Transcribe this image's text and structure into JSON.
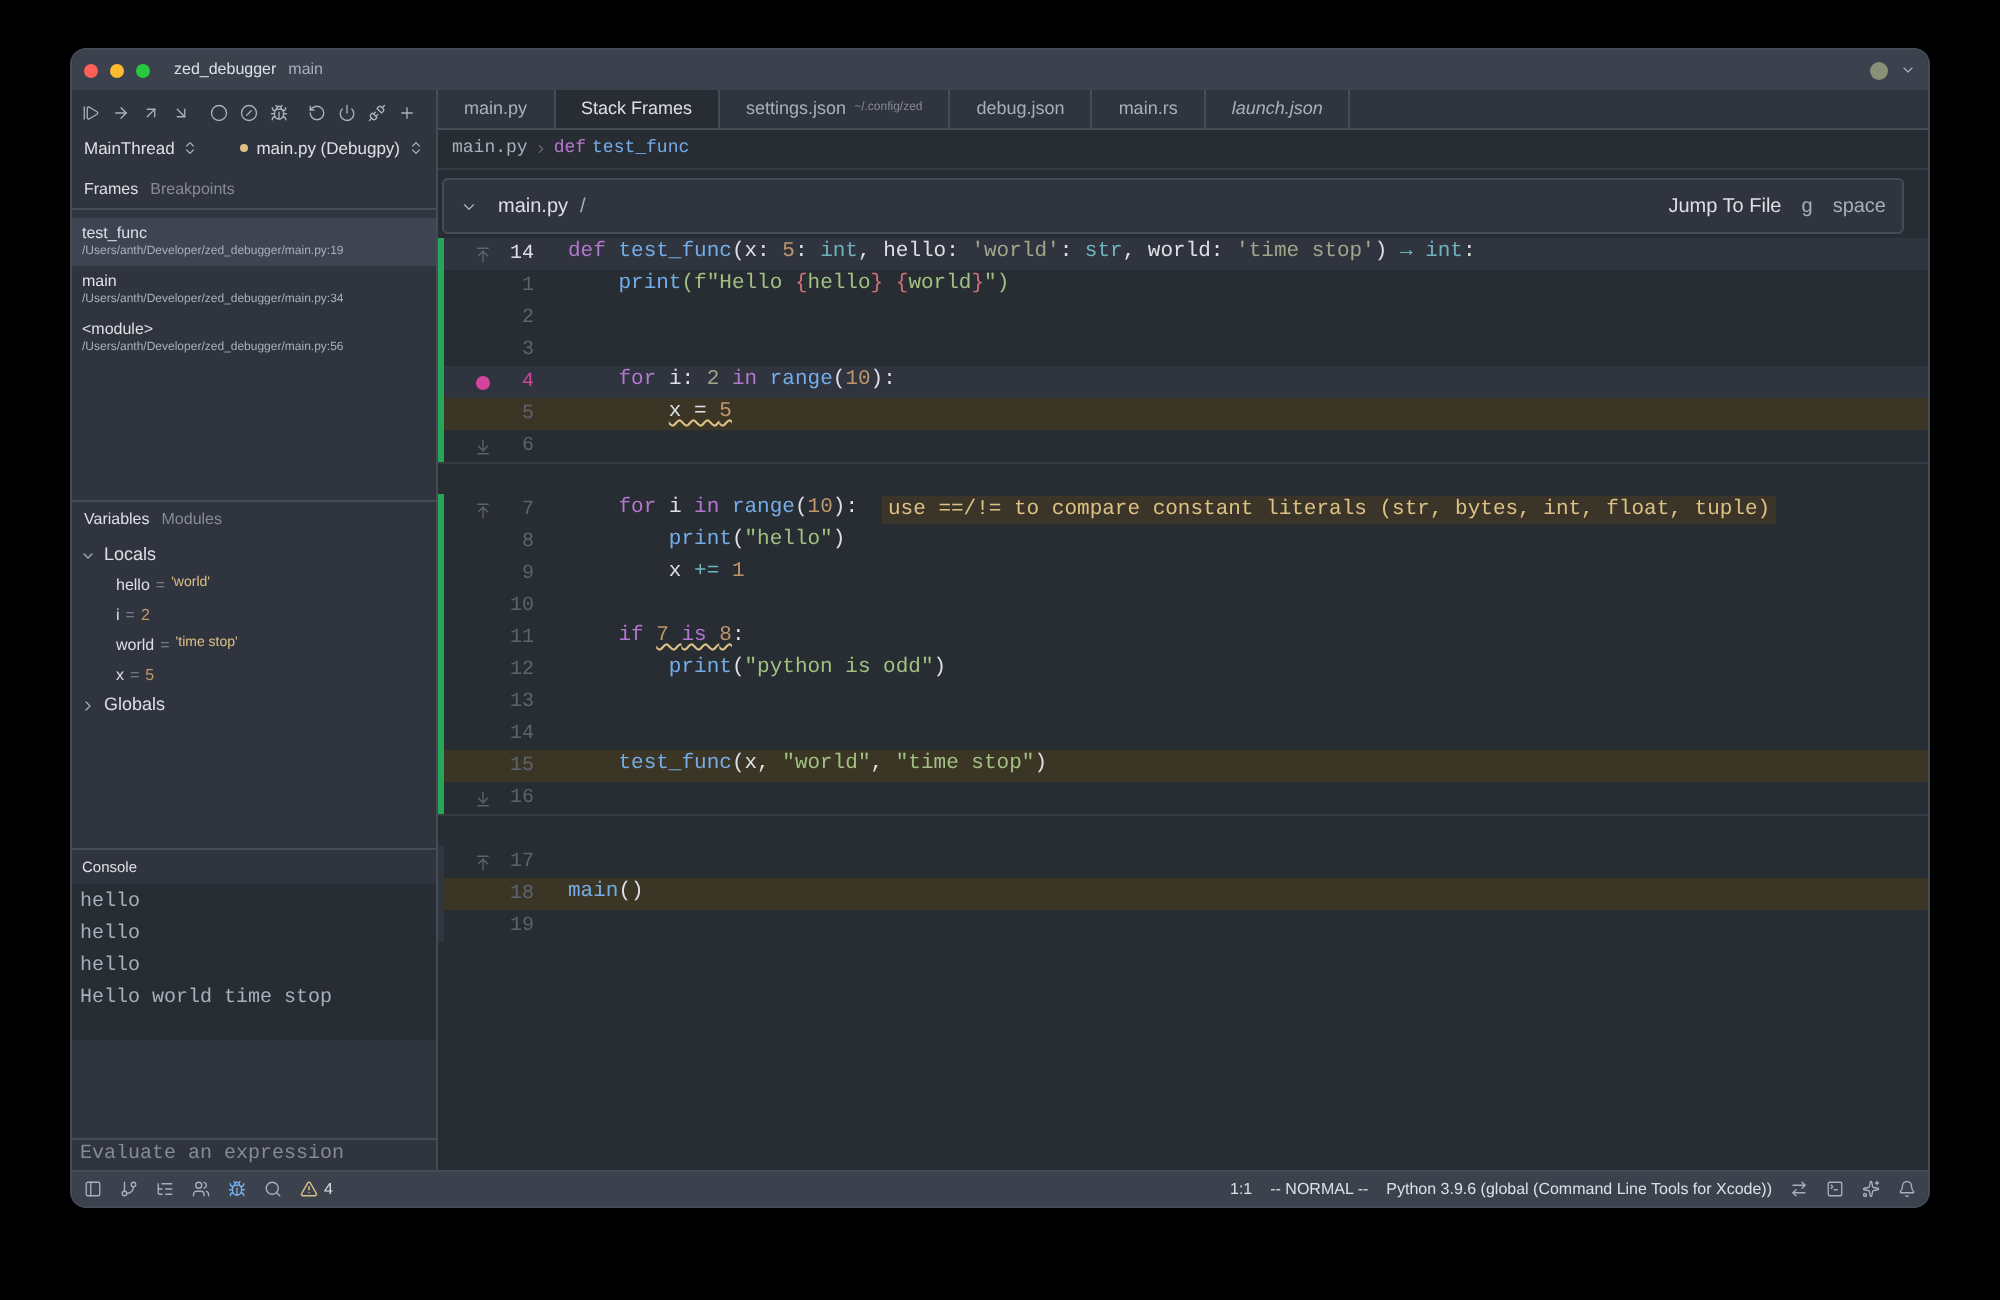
{
  "window": {
    "title": "zed_debugger",
    "branch": "main"
  },
  "debug_panel": {
    "thread": "MainThread",
    "session": "main.py (Debugpy)",
    "frame_tabs": [
      {
        "label": "Frames",
        "selected": true
      },
      {
        "label": "Breakpoints",
        "selected": false
      }
    ],
    "frames": [
      {
        "name": "test_func",
        "path": "/Users/anth/Developer/zed_debugger/main.py:19",
        "selected": true
      },
      {
        "name": "main",
        "path": "/Users/anth/Developer/zed_debugger/main.py:34",
        "selected": false
      },
      {
        "name": "<module>",
        "path": "/Users/anth/Developer/zed_debugger/main.py:56",
        "selected": false
      }
    ],
    "variable_tabs": [
      {
        "label": "Variables",
        "selected": true
      },
      {
        "label": "Modules",
        "selected": false
      }
    ],
    "scopes": [
      {
        "name": "Locals",
        "expanded": true,
        "children": [
          {
            "name": "hello",
            "sign": "=",
            "value": "'world'",
            "kind": "string"
          },
          {
            "name": "i",
            "sign": "=",
            "value": "2",
            "kind": "number"
          },
          {
            "name": "world",
            "sign": "=",
            "value": "'time stop'",
            "kind": "string"
          },
          {
            "name": "x",
            "sign": "=",
            "value": "5",
            "kind": "number"
          }
        ]
      },
      {
        "name": "Globals",
        "expanded": false
      }
    ],
    "console": {
      "title": "Console",
      "lines": [
        "hello",
        "hello",
        "hello",
        "Hello world time stop"
      ],
      "placeholder": "Evaluate an expression"
    }
  },
  "tabs": [
    {
      "label": "main.py",
      "selected": false,
      "preview": false
    },
    {
      "label": "Stack Frames",
      "selected": true,
      "preview": false
    },
    {
      "label": "settings.json",
      "detail": "~/.config/zed",
      "selected": false,
      "preview": false
    },
    {
      "label": "debug.json",
      "selected": false,
      "preview": false
    },
    {
      "label": "main.rs",
      "selected": false,
      "preview": false
    },
    {
      "label": "launch.json",
      "selected": false,
      "preview": true
    }
  ],
  "breadcrumb": {
    "file": "main.py",
    "keyword": "def",
    "symbol": "test_func"
  },
  "excerpt_header": {
    "file": "main.py",
    "path": "/",
    "action": "Jump To File",
    "keys": [
      "g",
      "space"
    ]
  },
  "excerpts": [
    {
      "changed": true,
      "lines": [
        {
          "number": "14",
          "active": true,
          "paused": false,
          "breakpoint": false,
          "expand_up": true,
          "expand_down": false,
          "tokens": [
            {
              "t": "def ",
              "color": "#b477cf"
            },
            {
              "t": "test_func",
              "color": "#74ade8"
            },
            {
              "t": "(x: ",
              "color": "#dce0e5"
            },
            {
              "t": "5",
              "color": "#bf956a"
            },
            {
              "t": ": ",
              "color": "#dce0e5"
            },
            {
              "t": "int",
              "color": "#6eb4bf"
            },
            {
              "t": ", hello: ",
              "color": "#dce0e5"
            },
            {
              "t": "'world'",
              "color": "#a1a58a"
            },
            {
              "t": ": ",
              "color": "#dce0e5"
            },
            {
              "t": "str",
              "color": "#6eb4bf"
            },
            {
              "t": ", world: ",
              "color": "#dce0e5"
            },
            {
              "t": "'time stop'",
              "color": "#a1a58a"
            },
            {
              "t": ") ",
              "color": "#dce0e5"
            },
            {
              "t": "→ int",
              "color": "#6eb4bf"
            },
            {
              "t": ":",
              "color": "#dce0e5"
            }
          ]
        },
        {
          "number": "1",
          "active": false,
          "paused": false,
          "breakpoint": false,
          "expand_up": false,
          "expand_down": false,
          "tokens": [
            {
              "t": "    print",
              "color": "#74ade8"
            },
            {
              "t": "(f\"Hello ",
              "color": "#a1c181"
            },
            {
              "t": "{",
              "color": "#d07277"
            },
            {
              "t": "hello",
              "color": "#a1c181"
            },
            {
              "t": "} ",
              "color": "#d07277"
            },
            {
              "t": "{",
              "color": "#d07277"
            },
            {
              "t": "world",
              "color": "#a1c181"
            },
            {
              "t": "}",
              "color": "#d07277"
            },
            {
              "t": "\")",
              "color": "#a1c181"
            }
          ]
        },
        {
          "number": "2",
          "active": false,
          "paused": false,
          "breakpoint": false,
          "expand_up": false,
          "expand_down": false
        },
        {
          "number": "3",
          "active": false,
          "paused": false,
          "breakpoint": false,
          "expand_up": false,
          "expand_down": false
        },
        {
          "number": "4",
          "active": true,
          "paused": false,
          "breakpoint": true,
          "expand_up": false,
          "expand_down": false,
          "tokens": [
            {
              "t": "    for",
              "color": "#b477cf"
            },
            {
              "t": " i: ",
              "color": "#dce0e5"
            },
            {
              "t": "2 ",
              "color": "#a1a58a"
            },
            {
              "t": "in ",
              "color": "#b477cf"
            },
            {
              "t": "range",
              "color": "#74ade8"
            },
            {
              "t": "(",
              "color": "#dce0e5"
            },
            {
              "t": "10",
              "color": "#bf956a"
            },
            {
              "t": "):",
              "color": "#dce0e5"
            }
          ]
        },
        {
          "number": "5",
          "active": false,
          "paused": true,
          "breakpoint": false,
          "expand_up": false,
          "expand_down": false,
          "tokens": [
            {
              "t": "        x = ",
              "color": "#dce0e5",
              "squiggle": true
            },
            {
              "t": "5",
              "color": "#bf956a",
              "squiggle": true
            }
          ]
        },
        {
          "number": "6",
          "active": false,
          "paused": false,
          "breakpoint": false,
          "expand_up": false,
          "expand_down": true
        }
      ]
    },
    {
      "changed": true,
      "lines": [
        {
          "number": "7",
          "active": false,
          "paused": false,
          "breakpoint": false,
          "expand_up": true,
          "expand_down": false,
          "diagnostic": "use ==/!= to compare constant literals (str, bytes, int, float, tuple)",
          "tokens": [
            {
              "t": "    for",
              "color": "#b477cf"
            },
            {
              "t": " i ",
              "color": "#dce0e5"
            },
            {
              "t": "in ",
              "color": "#b477cf"
            },
            {
              "t": "range",
              "color": "#74ade8"
            },
            {
              "t": "(",
              "color": "#dce0e5"
            },
            {
              "t": "10",
              "color": "#bf956a"
            },
            {
              "t": "):",
              "color": "#dce0e5"
            }
          ]
        },
        {
          "number": "8",
          "active": false,
          "paused": false,
          "breakpoint": false,
          "expand_up": false,
          "expand_down": false,
          "tokens": [
            {
              "t": "        print",
              "color": "#74ade8"
            },
            {
              "t": "(",
              "color": "#dce0e5"
            },
            {
              "t": "\"hello\"",
              "color": "#a1c181"
            },
            {
              "t": ")",
              "color": "#dce0e5"
            }
          ]
        },
        {
          "number": "9",
          "active": false,
          "paused": false,
          "breakpoint": false,
          "expand_up": false,
          "expand_down": false,
          "tokens": [
            {
              "t": "        x ",
              "color": "#dce0e5"
            },
            {
              "t": "+= ",
              "color": "#6eb4bf"
            },
            {
              "t": "1",
              "color": "#bf956a"
            }
          ]
        },
        {
          "number": "10",
          "active": false,
          "paused": false,
          "breakpoint": false,
          "expand_up": false,
          "expand_down": false
        },
        {
          "number": "11",
          "active": false,
          "paused": false,
          "breakpoint": false,
          "expand_up": false,
          "expand_down": false,
          "tokens": [
            {
              "t": "    if ",
              "color": "#b477cf"
            },
            {
              "t": "7 ",
              "color": "#bf956a",
              "squiggle": true
            },
            {
              "t": "is ",
              "color": "#b477cf",
              "squiggle": true
            },
            {
              "t": "8",
              "color": "#bf956a",
              "squiggle": true
            },
            {
              "t": ":",
              "color": "#dce0e5"
            }
          ]
        },
        {
          "number": "12",
          "active": false,
          "paused": false,
          "breakpoint": false,
          "expand_up": false,
          "expand_down": false,
          "tokens": [
            {
              "t": "        print",
              "color": "#74ade8"
            },
            {
              "t": "(",
              "color": "#dce0e5"
            },
            {
              "t": "\"python is odd\"",
              "color": "#a1c181"
            },
            {
              "t": ")",
              "color": "#dce0e5"
            }
          ]
        },
        {
          "number": "13",
          "active": false,
          "paused": false,
          "breakpoint": false,
          "expand_up": false,
          "expand_down": false
        },
        {
          "number": "14",
          "active": false,
          "paused": false,
          "breakpoint": false,
          "expand_up": false,
          "expand_down": false
        },
        {
          "number": "15",
          "active": false,
          "paused": true,
          "breakpoint": false,
          "expand_up": false,
          "expand_down": false,
          "tokens": [
            {
              "t": "    test_func",
              "color": "#74ade8"
            },
            {
              "t": "(x, ",
              "color": "#dce0e5"
            },
            {
              "t": "\"world\"",
              "color": "#a1c181"
            },
            {
              "t": ", ",
              "color": "#dce0e5"
            },
            {
              "t": "\"time stop\"",
              "color": "#a1c181"
            },
            {
              "t": ")",
              "color": "#dce0e5"
            }
          ]
        },
        {
          "number": "16",
          "active": false,
          "paused": false,
          "breakpoint": false,
          "expand_up": false,
          "expand_down": true
        }
      ]
    },
    {
      "changed": false,
      "lines": [
        {
          "number": "17",
          "active": false,
          "paused": false,
          "breakpoint": false,
          "expand_up": true,
          "expand_down": false
        },
        {
          "number": "18",
          "active": false,
          "paused": true,
          "breakpoint": false,
          "expand_up": false,
          "expand_down": false,
          "tokens": [
            {
              "t": "main",
              "color": "#74ade8"
            },
            {
              "t": "()",
              "color": "#dce0e5"
            }
          ]
        },
        {
          "number": "19",
          "active": false,
          "paused": false,
          "breakpoint": false,
          "expand_up": false,
          "expand_down": false
        }
      ]
    }
  ],
  "status_bar": {
    "warnings": "4",
    "position": "1:1",
    "mode": "-- NORMAL --",
    "toolchain": "Python 3.9.6 (global (Command Line Tools for Xcode))"
  }
}
